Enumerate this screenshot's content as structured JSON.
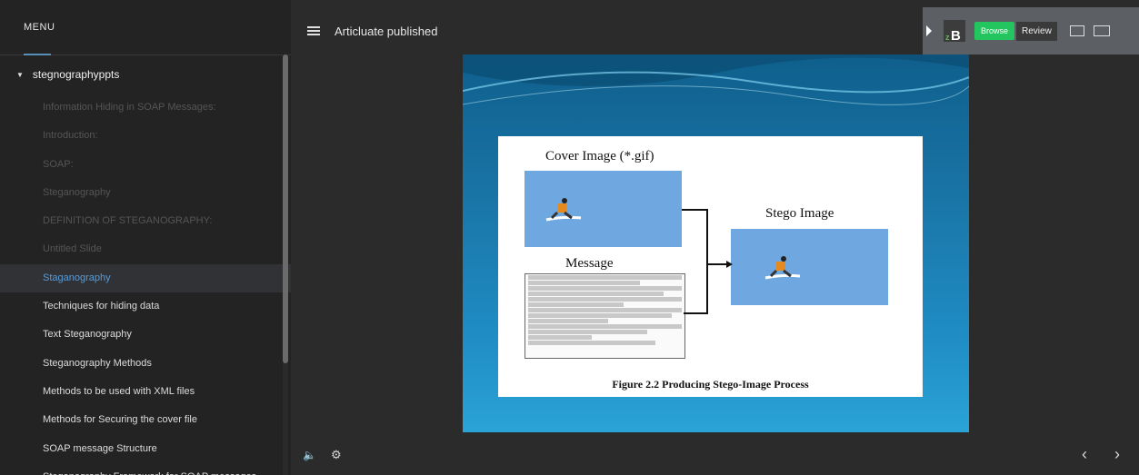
{
  "sidebar": {
    "menu_label": "MENU",
    "group_title": "stegnographyppts",
    "items": [
      {
        "label": "Information Hiding in SOAP Messages:",
        "state": "unvisited"
      },
      {
        "label": "Introduction:",
        "state": "unvisited"
      },
      {
        "label": "SOAP:",
        "state": "unvisited"
      },
      {
        "label": "Steganography",
        "state": "unvisited"
      },
      {
        "label": "DEFINITION OF STEGANOGRAPHY:",
        "state": "unvisited"
      },
      {
        "label": "Untitled Slide",
        "state": "unvisited"
      },
      {
        "label": "Staganography",
        "state": "active"
      },
      {
        "label": "Techniques for hiding data",
        "state": "visited"
      },
      {
        "label": "Text Steganography",
        "state": "visited"
      },
      {
        "label": "Steganography Methods",
        "state": "visited"
      },
      {
        "label": "Methods to be used with XML files",
        "state": "visited"
      },
      {
        "label": "Methods for Securing the cover file",
        "state": "visited"
      },
      {
        "label": "SOAP message Structure",
        "state": "visited"
      },
      {
        "label": "Steganography Framework for SOAP messages",
        "state": "visited"
      }
    ]
  },
  "header": {
    "title": "Articluate published"
  },
  "review_panel": {
    "logo_text": "zB",
    "browse_label": "Browse",
    "review_label": "Review",
    "accent_color": "#22c55e"
  },
  "slide": {
    "cover_label": "Cover Image (*.gif)",
    "stego_label": "Stego Image",
    "message_label": "Message",
    "caption": "Figure 2.2  Producing Stego-Image Process"
  },
  "controls": {
    "volume_icon": "speaker-icon",
    "settings_icon": "gear-icon",
    "prev_icon": "chevron-left-icon",
    "next_icon": "chevron-right-icon"
  }
}
